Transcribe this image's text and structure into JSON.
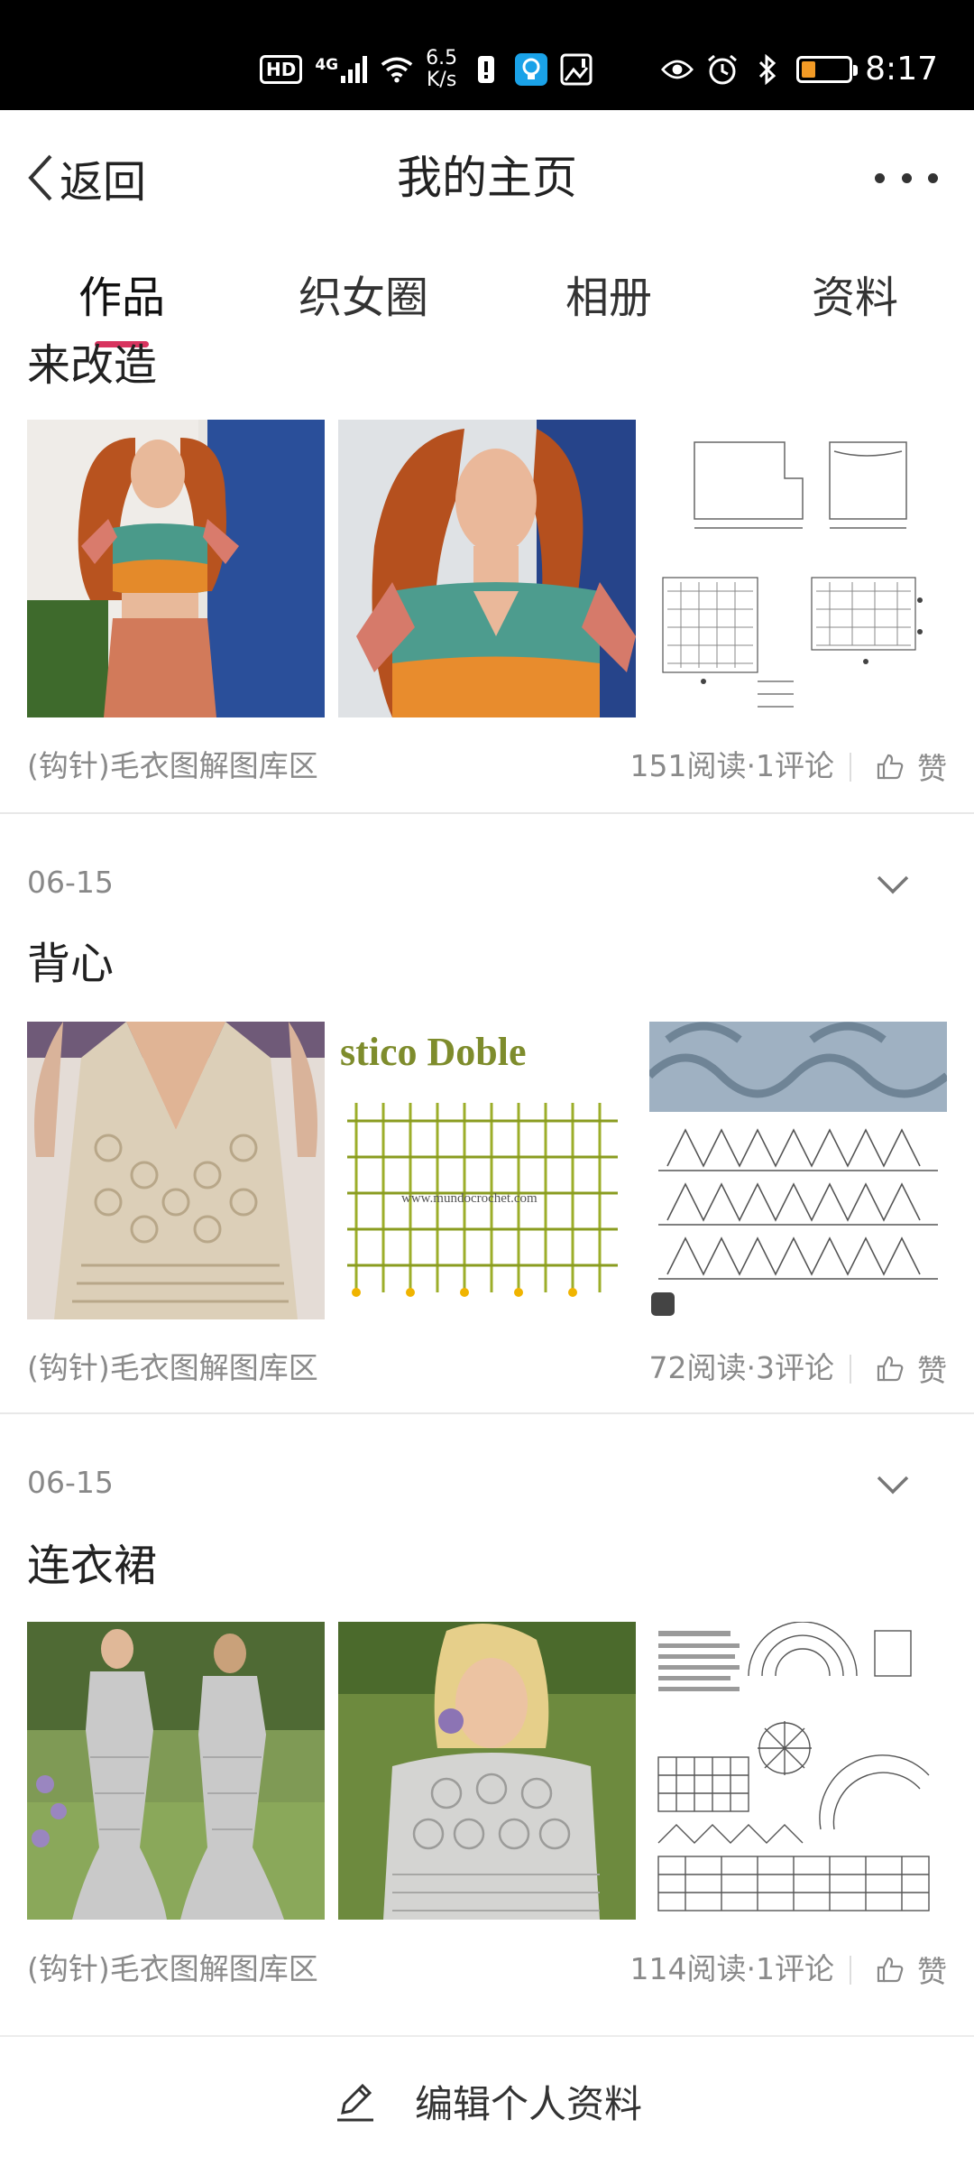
{
  "status_bar": {
    "hd": "HD",
    "signal": "4G",
    "speed_value": "6.5",
    "speed_unit": "K/s",
    "time": "8:17",
    "battery_level": 0.3,
    "battery_color": "#f29a25"
  },
  "header": {
    "back_label": "返回",
    "title": "我的主页"
  },
  "tabs": [
    {
      "label": "作品",
      "active": true
    },
    {
      "label": "织女圈",
      "active": false
    },
    {
      "label": "相册",
      "active": false
    },
    {
      "label": "资料",
      "active": false
    }
  ],
  "tab_indicator_color": "#d8345f",
  "posts": [
    {
      "title": "来改造",
      "date": "",
      "images": [
        "crochet-crop-top-photo",
        "crochet-crop-top-closeup",
        "sweater-pattern-chart"
      ],
      "source": "(钩针)毛衣图解图库区",
      "stats": "151阅读·1评论",
      "like_label": "赞"
    },
    {
      "title": "背心",
      "date": "06-15",
      "images": [
        "crochet-vest-photo",
        "stitch-chart-photo",
        "stitch-diagram-photo"
      ],
      "image_text": {
        "stitch_title": "stico Doble",
        "watermark": "www.mundocrochet.com"
      },
      "source": "(钩针)毛衣图解图库区",
      "stats": "72阅读·3评论",
      "like_label": "赞"
    },
    {
      "title": "连衣裙",
      "date": "06-15",
      "images": [
        "crochet-dress-photo",
        "crochet-dress-closeup",
        "dress-pattern-chart"
      ],
      "source": "(钩针)毛衣图解图库区",
      "stats": "114阅读·1评论",
      "like_label": "赞"
    }
  ],
  "bottom": {
    "edit_label": "编辑个人资料"
  }
}
